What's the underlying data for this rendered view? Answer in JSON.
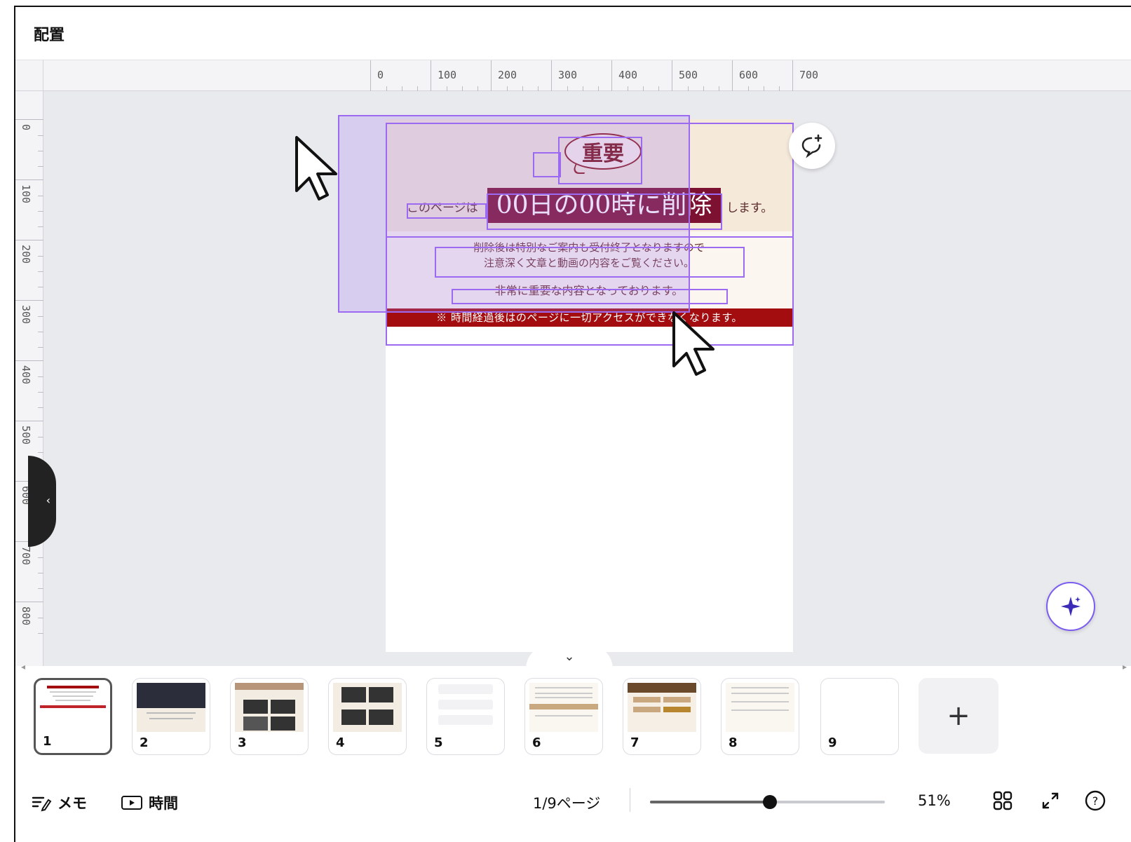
{
  "header": {
    "title": "配置"
  },
  "ruler": {
    "horizontal": [
      "0",
      "100",
      "200",
      "300",
      "400",
      "500",
      "600",
      "700"
    ],
    "vertical": [
      "0",
      "100",
      "200",
      "300",
      "400",
      "500",
      "600",
      "700",
      "800"
    ]
  },
  "design": {
    "bubble_label": "重要",
    "headline_pre": "このページは",
    "headline_main": "00日の00時に削除",
    "headline_post": "します。",
    "notice_line1": "削除後は特別なご案内も受付終了となりますので",
    "notice_line2": "注意深く文章と動画の内容をご覧ください。",
    "notice_important": "非常に重要な内容となっております。",
    "red_bar": "※ 時間経過後はのページに一切アクセスができなくなります。",
    "colors": {
      "headline_bg": "#7d1131",
      "red_bar": "#a30d10",
      "band": "#f5e9da"
    }
  },
  "filmstrip": {
    "pages": [
      "1",
      "2",
      "3",
      "4",
      "5",
      "6",
      "7",
      "8",
      "9"
    ],
    "active_page": "1",
    "add_icon": "plus-icon"
  },
  "bottombar": {
    "notes_label": "メモ",
    "timer_label": "時間",
    "page_indicator": "1/9ページ",
    "zoom_percent": "51%",
    "zoom_fraction": 0.51
  },
  "icons": {
    "comment": "comment-add-icon",
    "magic": "sparkle-icon",
    "grid": "grid-view-icon",
    "fullscreen": "expand-icon",
    "help": "help-icon"
  },
  "accent": "#9b6af0"
}
